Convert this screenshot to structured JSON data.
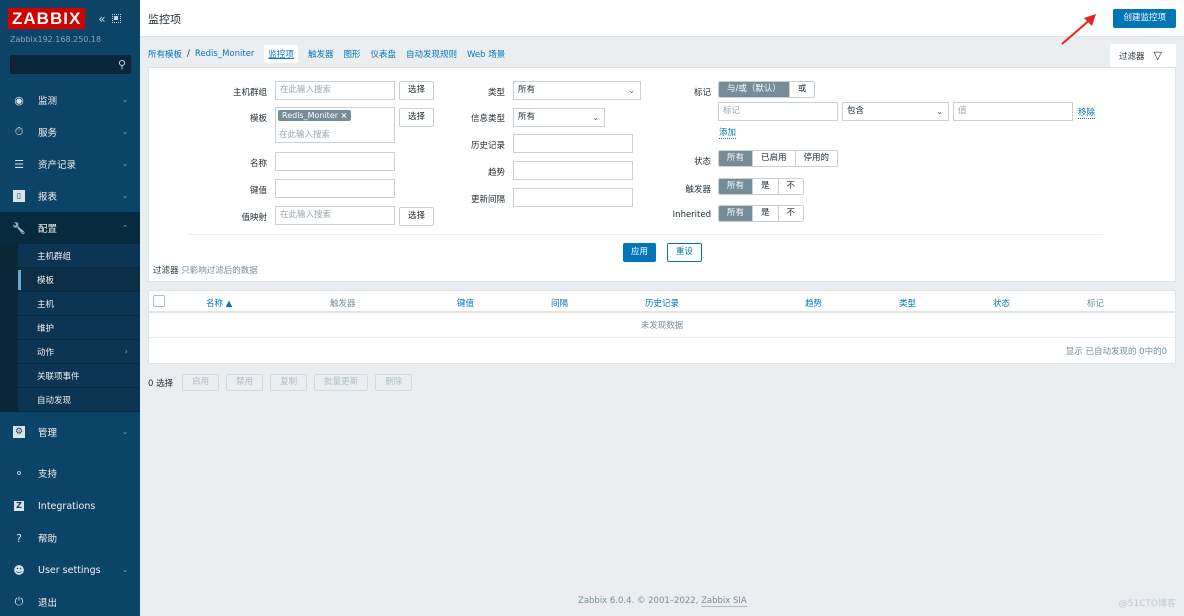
{
  "sidebar": {
    "logo": "ZABBIX",
    "server_name": "Zabbix192.168.250.18",
    "search_placeholder": "",
    "main_items": [
      {
        "label": "监测",
        "icon": "eye-icon",
        "expanded": false
      },
      {
        "label": "服务",
        "icon": "stopwatch-icon",
        "expanded": false
      },
      {
        "label": "资产记录",
        "icon": "list-icon",
        "expanded": false
      },
      {
        "label": "报表",
        "icon": "bar-chart-icon",
        "expanded": false
      },
      {
        "label": "配置",
        "icon": "wrench-icon",
        "expanded": true
      },
      {
        "label": "管理",
        "icon": "gear-icon",
        "expanded": false
      }
    ],
    "config_sub_items": [
      {
        "label": "主机群组"
      },
      {
        "label": "模板",
        "selected": true
      },
      {
        "label": "主机"
      },
      {
        "label": "维护"
      },
      {
        "label": "动作",
        "has_submenu": true
      },
      {
        "label": "关联项事件"
      },
      {
        "label": "自动发现"
      }
    ],
    "bottom_items": [
      {
        "label": "支持",
        "icon": "headset-icon"
      },
      {
        "label": "Integrations",
        "icon": "zabbix-z-icon"
      },
      {
        "label": "帮助",
        "icon": "question-icon"
      },
      {
        "label": "User settings",
        "icon": "user-icon",
        "has_submenu": true
      },
      {
        "label": "退出",
        "icon": "power-icon"
      }
    ]
  },
  "header": {
    "title": "监控项",
    "create_button": "创建监控项"
  },
  "breadcrumb": {
    "all_templates": "所有模板",
    "separator": "/",
    "template": "Redis_Moniter",
    "tabs": [
      "监控项",
      "触发器",
      "图形",
      "仪表盘",
      "自动发现规则",
      "Web 场景"
    ],
    "active_tab": "监控项"
  },
  "filter": {
    "tab_label": "过滤器",
    "host_group": {
      "label": "主机群组",
      "placeholder": "在此输入搜索",
      "button": "选择"
    },
    "template": {
      "label": "模板",
      "chip": "Redis_Moniter",
      "chip_remove": "×",
      "placeholder": "在此输入搜索",
      "button": "选择"
    },
    "name": {
      "label": "名称",
      "value": ""
    },
    "key": {
      "label": "键值",
      "value": ""
    },
    "value_map": {
      "label": "值映射",
      "placeholder": "在此输入搜索",
      "button": "选择"
    },
    "type": {
      "label": "类型",
      "value": "所有"
    },
    "info_type": {
      "label": "信息类型",
      "value": "所有"
    },
    "history": {
      "label": "历史记录",
      "value": ""
    },
    "trends": {
      "label": "趋势",
      "value": ""
    },
    "update_interval": {
      "label": "更新间隔",
      "value": ""
    },
    "tags": {
      "label": "标记",
      "mode_options": [
        "与/或（默认）",
        "或"
      ],
      "mode_selected": "与/或（默认）",
      "tag_placeholder": "标记",
      "operator": "包含",
      "value_placeholder": "值",
      "remove": "移除",
      "add": "添加"
    },
    "state": {
      "label": "状态",
      "options": [
        "所有",
        "已启用",
        "停用的"
      ],
      "selected": "所有"
    },
    "triggers": {
      "label": "触发器",
      "options": [
        "所有",
        "是",
        "不"
      ],
      "selected": "所有"
    },
    "inherited": {
      "label": "Inherited",
      "options": [
        "所有",
        "是",
        "不"
      ],
      "selected": "所有"
    },
    "apply": "应用",
    "reset": "重设",
    "note_label": "过滤器",
    "note_text": "只影响过滤后的数据"
  },
  "table": {
    "columns": [
      "名称 ▲",
      "触发器",
      "键值",
      "间隔",
      "历史记录",
      "趋势",
      "类型",
      "状态",
      "标记"
    ],
    "empty_text": "未发现数据",
    "paging": "显示 已自动发现的 0中的0"
  },
  "actions": {
    "selected_count": "0 选择",
    "buttons": [
      "启用",
      "禁用",
      "复制",
      "批量更新",
      "删除"
    ]
  },
  "footer": {
    "text": "Zabbix 6.0.4. © 2001–2022, ",
    "link": "Zabbix SIA",
    "watermark": "@51CTO博客"
  }
}
